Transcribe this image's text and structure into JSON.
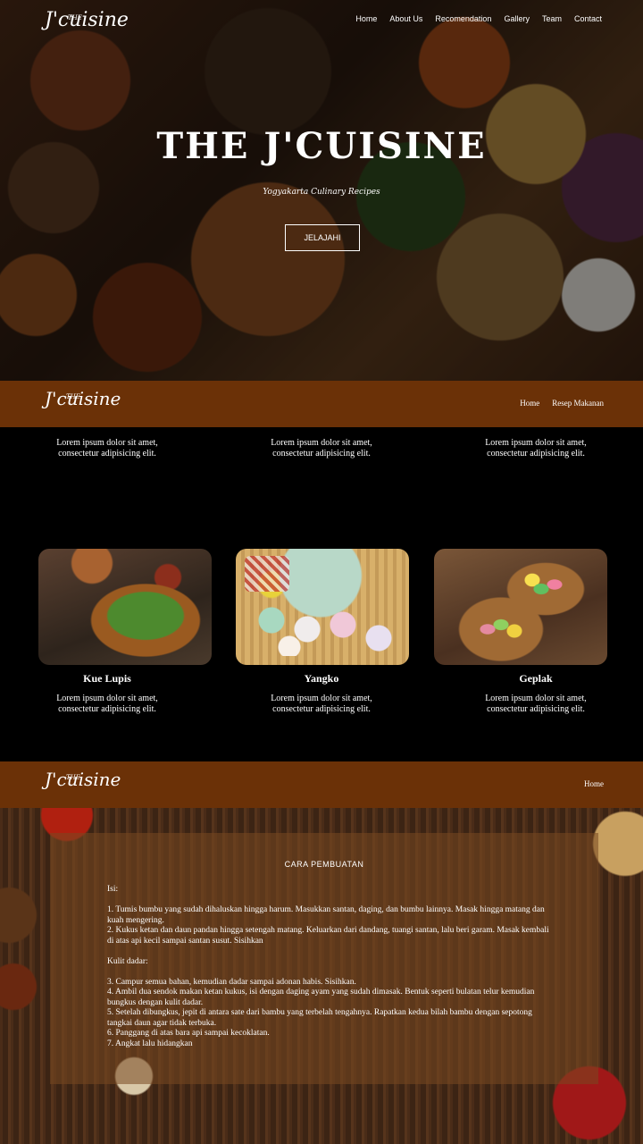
{
  "hero": {
    "logo": {
      "main": "J'cuisine",
      "prefix": "THE"
    },
    "nav": [
      "Home",
      "About Us",
      "Recomendation",
      "Gallery",
      "Team",
      "Contact"
    ],
    "title": "THE J'CUISINE",
    "subtitle": "Yogyakarta Culinary Recipes",
    "button": "JELAJAHI"
  },
  "navbar1": {
    "logo": {
      "main": "J'cuisine",
      "prefix": "THE"
    },
    "links": [
      "Home",
      "Resep Makanan"
    ]
  },
  "section1": {
    "top_descriptions": [
      "Lorem ipsum dolor sit amet, consectetur adipisicing elit.",
      "Lorem ipsum dolor sit amet, consectetur adipisicing elit.",
      "Lorem ipsum dolor sit amet, consectetur adipisicing elit."
    ],
    "cards": [
      {
        "title": "Kue Lupis",
        "desc": "Lorem ipsum dolor sit amet, consectetur adipisicing elit."
      },
      {
        "title": "Yangko",
        "desc": "Lorem ipsum dolor sit amet, consectetur adipisicing elit."
      },
      {
        "title": "Geplak",
        "desc": "Lorem ipsum dolor sit amet, consectetur adipisicing elit."
      }
    ]
  },
  "navbar2": {
    "logo": {
      "main": "J'cuisine",
      "prefix": "THE"
    },
    "links": [
      "Home"
    ]
  },
  "recipe": {
    "heading": "CARA PEMBUATAN",
    "isi_label": "Isi:",
    "isi_steps": [
      "1. Tumis bumbu yang sudah dihaluskan hingga harum. Masukkan santan, daging, dan bumbu lainnya. Masak hingga matang dan kuah mengering.",
      "2. Kukus ketan dan daun pandan hingga setengah matang. Keluarkan dari dandang, tuangi santan, lalu beri garam. Masak kembali di atas api kecil sampai santan susut. Sisihkan"
    ],
    "kulit_label": "Kulit dadar:",
    "kulit_steps": [
      "3. Campur semua bahan, kemudian dadar sampai adonan habis. Sisihkan.",
      "4. Ambil dua sendok makan ketan kukus, isi dengan daging ayam yang sudah dimasak. Bentuk seperti bulatan telur kemudian bungkus dengan kulit dadar.",
      "5. Setelah dibungkus, jepit di antara sate dari bambu yang terbelah tengahnya. Rapatkan kedua bilah bambu dengan sepotong tangkai daun agar tidak terbuka.",
      "6. Panggang di atas bara api sampai kecoklatan.",
      "7. Angkat lalu hidangkan"
    ]
  },
  "colors": {
    "nav_brown": "#6b3107",
    "page_bg": "#000000"
  }
}
